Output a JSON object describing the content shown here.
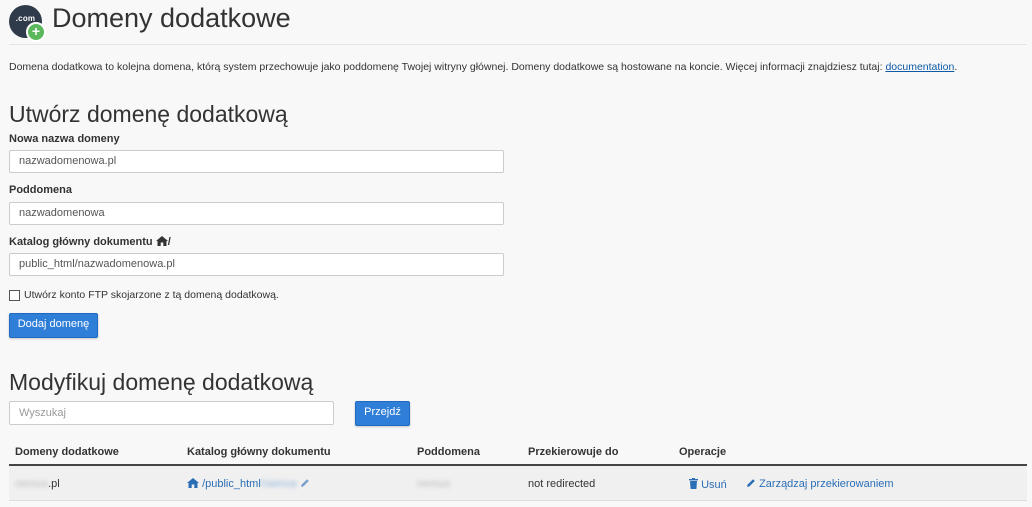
{
  "header": {
    "app_icon_text": ".com",
    "title": "Domeny dodatkowe"
  },
  "description": {
    "text": "Domena dodatkowa to kolejna domena, którą system przechowuje jako poddomenę Twojej witryny głównej. Domeny dodatkowe są hostowane na koncie. Więcej informacji znajdziesz tutaj: ",
    "link_text": "documentation",
    "suffix": "."
  },
  "create": {
    "heading": "Utwórz domenę dodatkową",
    "domain_label": "Nowa nazwa domeny",
    "domain_value": "nazwadomenowa.pl",
    "subdomain_label": "Poddomena",
    "subdomain_value": "nazwadomenowa",
    "docroot_label": "Katalog główny dokumentu",
    "docroot_suffix": "/",
    "docroot_value": "public_html/nazwadomenowa.pl",
    "ftp_checkbox_label": "Utwórz konto FTP skojarzone z tą domeną dodatkową.",
    "ftp_checked": false,
    "submit_label": "Dodaj domenę"
  },
  "modify": {
    "heading": "Modyfikuj domenę dodatkową",
    "search_placeholder": "Wyszukaj",
    "go_label": "Przejdź",
    "columns": [
      "Domeny dodatkowe",
      "Katalog główny dokumentu",
      "Poddomena",
      "Przekierowuje do",
      "Operacje"
    ],
    "rows": [
      {
        "domain_blurred": "nemus",
        "domain_suffix": ".pl",
        "docroot_prefix": "/public_html",
        "docroot_blurred": "/nemus",
        "subdomain_blurred": "nemus",
        "redirects_to": "not redirected",
        "remove_label": "Usuń",
        "manage_redirect_label": "Zarządzaj przekierowaniem"
      }
    ]
  },
  "colors": {
    "primary_button": "#2f7ed8",
    "link": "#2a6eb5",
    "background": "#f8f8f8"
  },
  "icons": {
    "app": "addon-domains-icon",
    "home": "home-icon",
    "pencil": "pencil-icon",
    "trash": "trash-icon"
  }
}
